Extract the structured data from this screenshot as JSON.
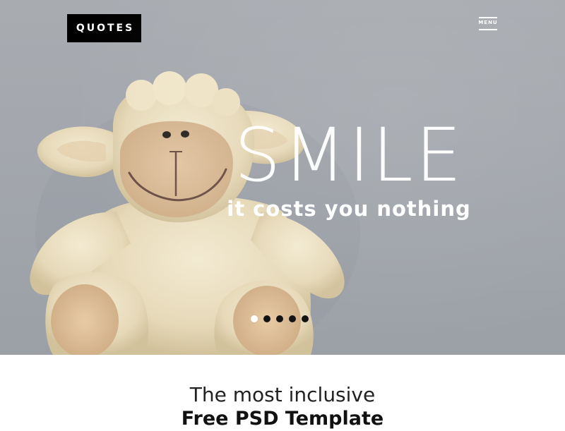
{
  "header": {
    "logo_text": "QUOTES",
    "menu_label": "MENU"
  },
  "hero": {
    "headline": "SMILE",
    "subline": "it costs you nothing",
    "slider": {
      "total_slides": 5,
      "active_slide": 1
    }
  },
  "intro": {
    "line1": "The most inclusive",
    "line2": "Free PSD Template"
  },
  "colors": {
    "hero_background": "#a3a7ad",
    "logo_background": "#000000",
    "text_light": "#ffffff",
    "dot_inactive": "#111111",
    "dot_active": "#ffffff"
  }
}
